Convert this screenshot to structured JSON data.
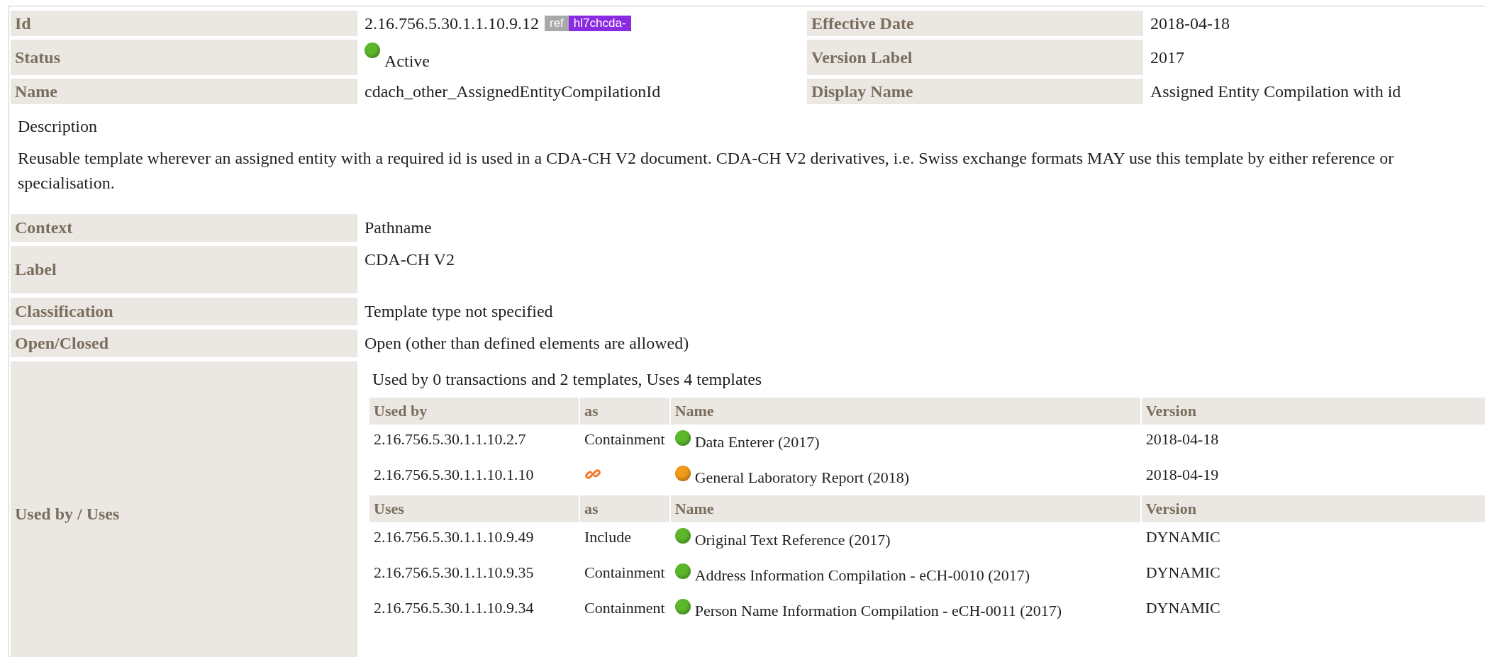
{
  "header": {
    "left": [
      {
        "label": "Id",
        "kind": "id",
        "value": "2.16.756.5.30.1.1.10.9.12",
        "ref": "ref",
        "prefix": "hl7chcda-"
      },
      {
        "label": "Status",
        "kind": "status",
        "value": "Active",
        "color": "#5cb82a"
      },
      {
        "label": "Name",
        "kind": "text",
        "value": "cdach_other_AssignedEntityCompilationId"
      }
    ],
    "right": [
      {
        "label": "Effective Date",
        "value": "2018-04-18"
      },
      {
        "label": "Version Label",
        "value": "2017"
      },
      {
        "label": "Display Name",
        "value": "Assigned Entity Compilation with id"
      }
    ]
  },
  "description": {
    "title": "Description",
    "text": "Reusable template wherever an assigned entity with a required id is used in a CDA-CH V2 document. CDA-CH V2 derivatives, i.e. Swiss exchange formats MAY use this template by either reference or specialisation."
  },
  "properties": [
    {
      "label": "Context",
      "value": "Pathname"
    },
    {
      "label": "Label",
      "value": "CDA-CH V2"
    },
    {
      "label": "Classification",
      "value": "Template type not specified"
    },
    {
      "label": "Open/Closed",
      "value": "Open (other than defined elements are allowed)"
    }
  ],
  "usage": {
    "label": "Used by / Uses",
    "summary": "Used by 0 transactions and 2 templates, Uses 4 templates",
    "sections": [
      {
        "columns": [
          "Used by",
          "as",
          "Name",
          "Version"
        ],
        "rows": [
          {
            "id": "2.16.756.5.30.1.1.10.2.7",
            "kind": "text",
            "as": "Containment",
            "name": "Data Enterer (2017)",
            "color": "#5cb82a",
            "version": "2018-04-18"
          },
          {
            "id": "2.16.756.5.30.1.1.10.1.10",
            "kind": "link",
            "name": "General Laboratory Report (2018)",
            "color": "#f29a1a",
            "version": "2018-04-19"
          }
        ]
      },
      {
        "columns": [
          "Uses",
          "as",
          "Name",
          "Version"
        ],
        "rows": [
          {
            "id": "2.16.756.5.30.1.1.10.9.49",
            "kind": "text",
            "as": "Include",
            "name": "Original Text Reference (2017)",
            "color": "#5cb82a",
            "version": "DYNAMIC"
          },
          {
            "id": "2.16.756.5.30.1.1.10.9.35",
            "kind": "text",
            "as": "Containment",
            "name": "Address Information Compilation - eCH-0010 (2017)",
            "color": "#5cb82a",
            "version": "DYNAMIC"
          },
          {
            "id": "2.16.756.5.30.1.1.10.9.34",
            "kind": "text",
            "as": "Containment",
            "name": "Person Name Information Compilation - eCH-0011 (2017)",
            "color": "#5cb82a",
            "version": "DYNAMIC"
          }
        ]
      }
    ]
  }
}
